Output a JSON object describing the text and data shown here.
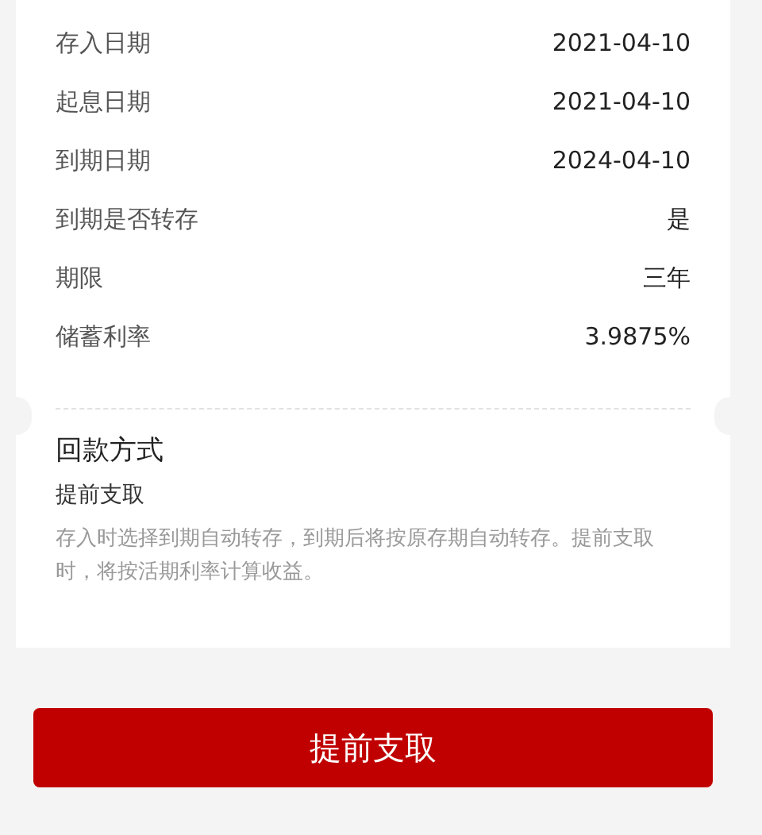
{
  "details": [
    {
      "label": "存入日期",
      "value": "2021-04-10"
    },
    {
      "label": "起息日期",
      "value": "2021-04-10"
    },
    {
      "label": "到期日期",
      "value": "2024-04-10"
    },
    {
      "label": "到期是否转存",
      "value": "是"
    },
    {
      "label": "期限",
      "value": "三年"
    },
    {
      "label": "储蓄利率",
      "value": "3.9875%"
    }
  ],
  "repayment": {
    "title": "回款方式",
    "method": "提前支取",
    "description": "存入时选择到期自动转存，到期后将按原存期自动转存。提前支取时，将按活期利率计算收益。"
  },
  "button": {
    "label": "提前支取"
  }
}
